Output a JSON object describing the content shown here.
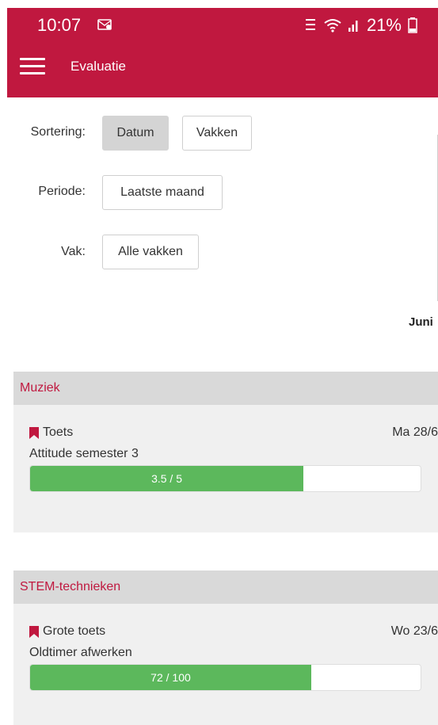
{
  "status_bar": {
    "time": "10:07",
    "battery": "21%",
    "icons": [
      "message-notification-icon",
      "volte-icon",
      "wifi-icon",
      "signal-icon",
      "battery-icon"
    ]
  },
  "app_bar": {
    "title": "Evaluatie",
    "color": "#c0183f"
  },
  "filters": {
    "sort_label": "Sortering:",
    "sort_options": [
      "Datum",
      "Vakken"
    ],
    "sort_selected": "Datum",
    "period_label": "Periode:",
    "period_value": "Laatste maand",
    "subject_label": "Vak:",
    "subject_value": "Alle vakken"
  },
  "calendar": {
    "month_label": "Juni"
  },
  "evaluations": [
    {
      "subject": "Muziek",
      "type": "Toets",
      "date": "Ma 28/6",
      "description": "Attitude semester 3",
      "score_text": "3.5 / 5",
      "score_fraction": 0.7
    },
    {
      "subject": "STEM-technieken",
      "type": "Grote toets",
      "date": "Wo 23/6",
      "description": "Oldtimer afwerken",
      "score_text": "72 / 100",
      "score_fraction": 0.72
    }
  ],
  "colors": {
    "accent": "#c0183f",
    "score_bar": "#5cb85c",
    "header_bg": "#d9d9d9",
    "card_bg": "#f0f0f0"
  }
}
